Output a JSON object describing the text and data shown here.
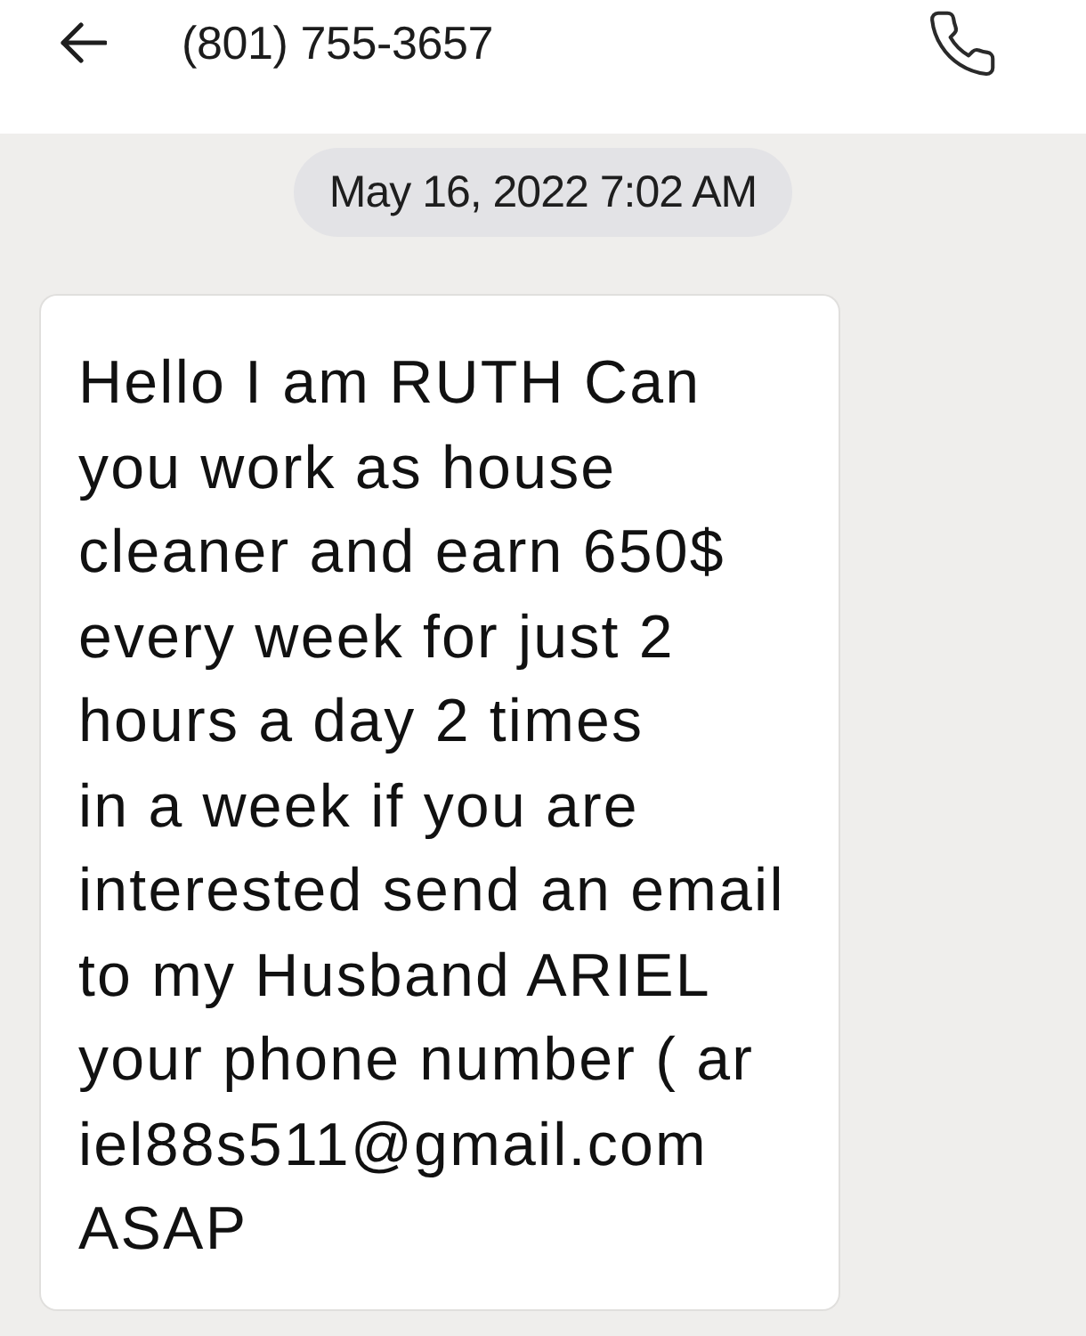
{
  "header": {
    "contact": "(801) 755-3657"
  },
  "date_separator": "May 16, 2022 7:02 AM",
  "messages": [
    {
      "kind": "incoming",
      "text": "Hello I am RUTH Can\nyou work as house\ncleaner and earn 650$\nevery week for just 2\nhours a day 2 times\nin a week if you are\ninterested send an email\nto my Husband ARIEL\nyour phone number ( ar\niel88s511@gmail.com\nASAP"
    }
  ]
}
